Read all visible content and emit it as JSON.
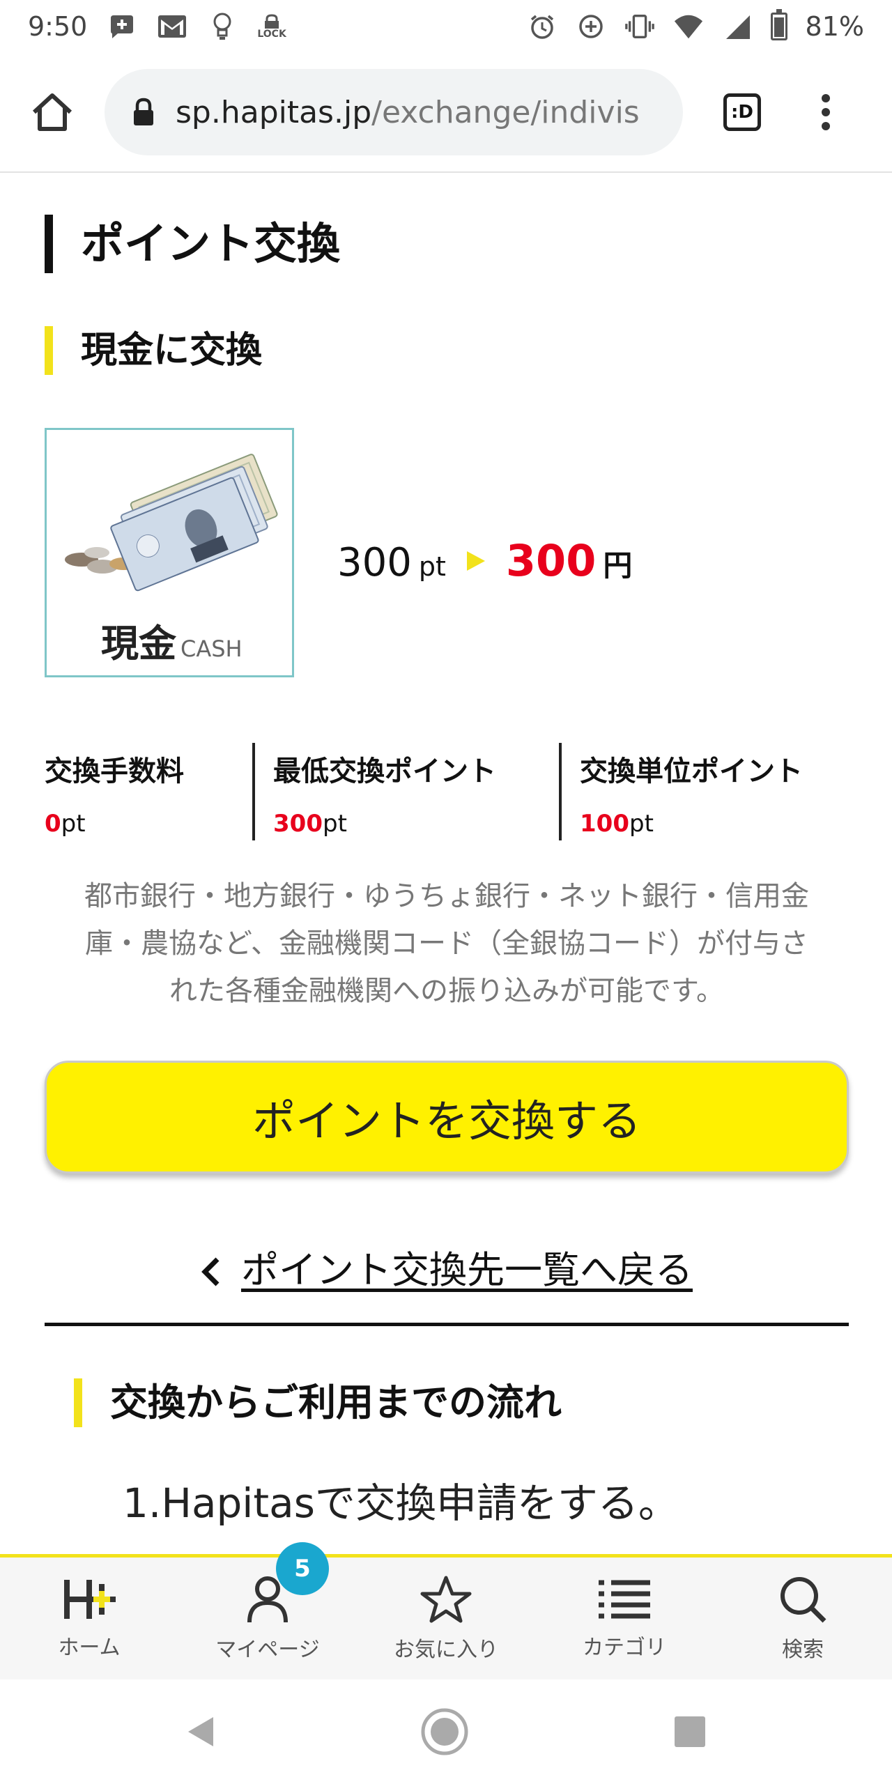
{
  "status_bar": {
    "time": "9:50",
    "lock_label": "LOCK",
    "battery_percent_text": "81%",
    "battery_level": 0.81
  },
  "browser": {
    "url_host": "sp.hapitas.jp",
    "url_path": "/exchange/indivis",
    "tab_icon_text": ":D"
  },
  "page": {
    "title": "ポイント交換",
    "section_title": "現金に交換",
    "card": {
      "label_jp": "現金",
      "label_en": "CASH"
    },
    "rate": {
      "points": "300",
      "points_unit": "pt",
      "yen_value": "300",
      "yen_unit": "円"
    },
    "stats": [
      {
        "title": "交換手数料",
        "value": "0",
        "unit": "pt"
      },
      {
        "title": "最低交換ポイント",
        "value": "300",
        "unit": "pt"
      },
      {
        "title": "交換単位ポイント",
        "value": "100",
        "unit": "pt"
      }
    ],
    "description_lines": [
      "都市銀行・地方銀行・ゆうちょ銀行・ネット銀行・信用金",
      "庫・農協など、金融機関コード（全銀協コード）が付与さ",
      "れた各種金融機関への振り込みが可能です。"
    ],
    "exchange_button": "ポイントを交換する",
    "back_link": "ポイント交換先一覧へ戻る",
    "flow_title": "交換からご利用までの流れ",
    "step1": "1.Hapitasで交換申請をする。"
  },
  "tabbar": {
    "items": [
      {
        "label": "ホーム",
        "icon": "home-logo-icon"
      },
      {
        "label": "マイページ",
        "icon": "user-icon",
        "badge": "5"
      },
      {
        "label": "お気に入り",
        "icon": "star-icon"
      },
      {
        "label": "カテゴリ",
        "icon": "list-icon"
      },
      {
        "label": "検索",
        "icon": "search-icon"
      }
    ]
  },
  "colors": {
    "accent_yellow": "#fff100",
    "red": "#e8001c",
    "badge_blue": "#1aa7cf",
    "card_border": "#7fc6c8"
  }
}
